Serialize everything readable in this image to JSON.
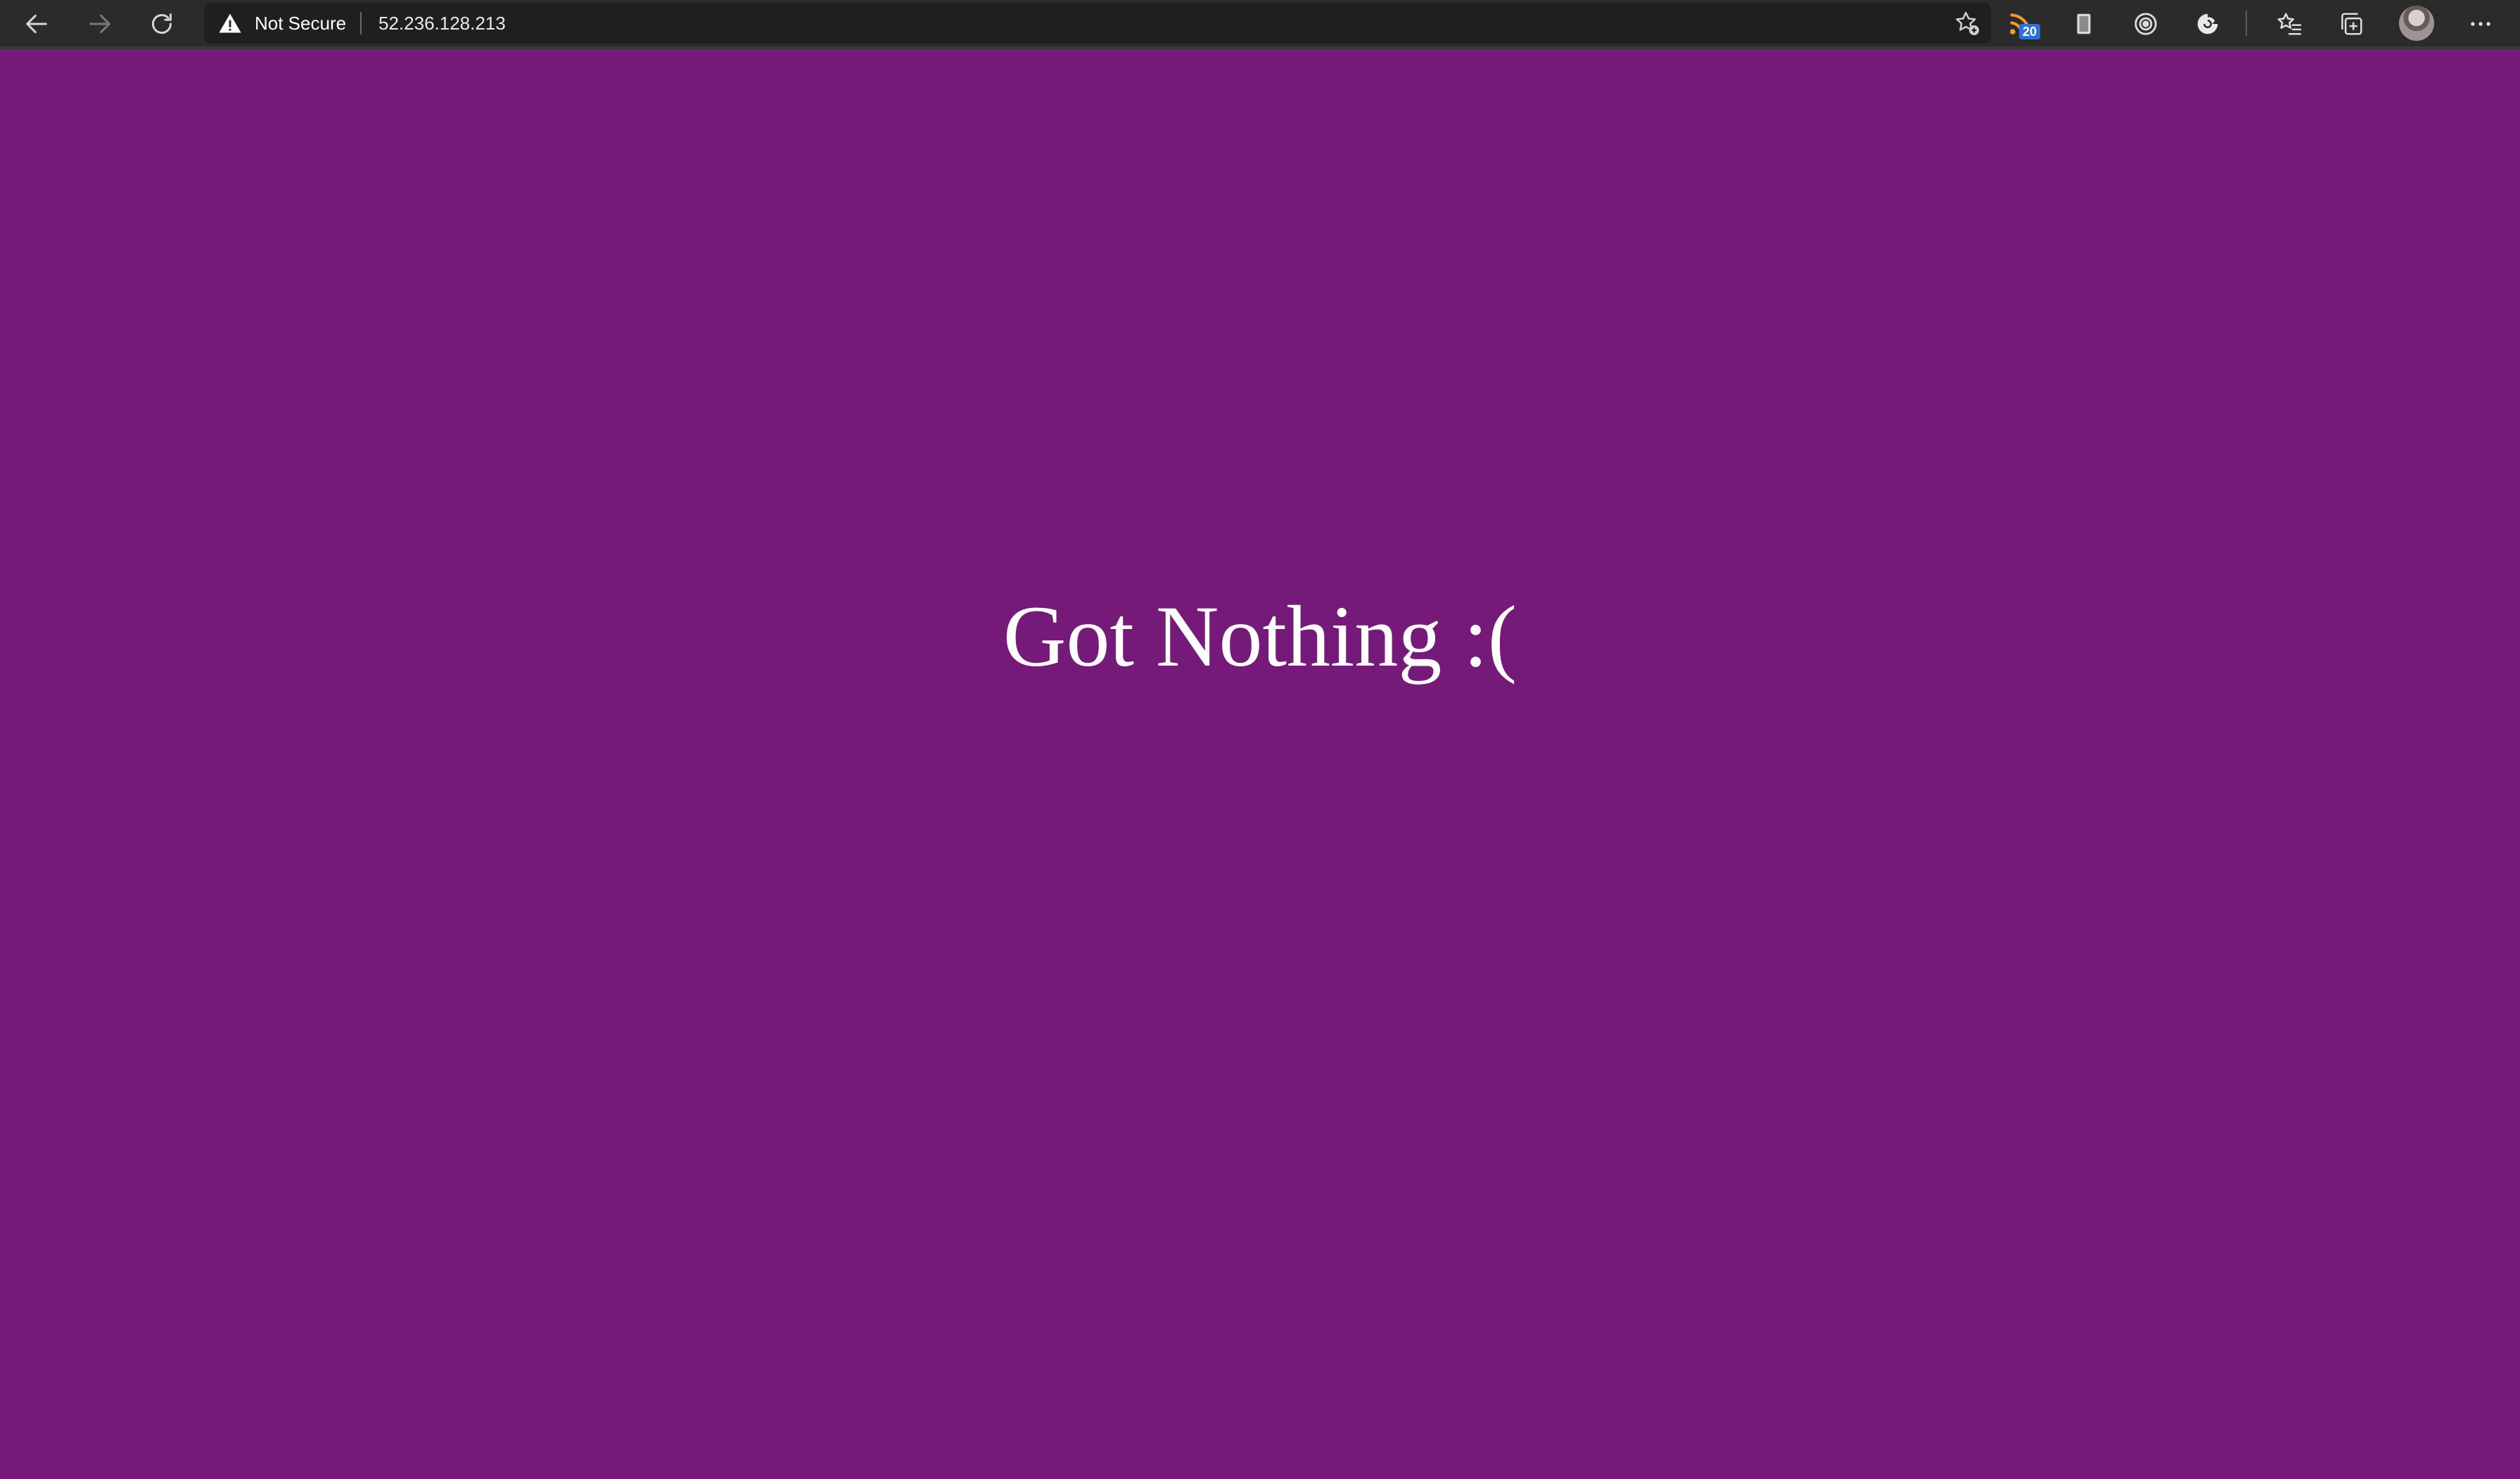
{
  "browser": {
    "address_bar": {
      "security_status": "Not Secure",
      "url": "52.236.128.213"
    },
    "extensions": {
      "rss_badge_count": "20"
    },
    "icons": {
      "back": "back-arrow-icon",
      "forward": "forward-arrow-icon",
      "reload": "reload-icon",
      "warning": "warning-triangle-icon",
      "add_favorite": "star-plus-icon",
      "rss": "rss-feed-icon",
      "extension_2": "bookmark-icon",
      "extension_3": "target-icon",
      "extension_4": "extension-undo-icon",
      "favorites": "favorites-list-icon",
      "collections": "collections-icon",
      "profile": "profile-avatar",
      "menu": "more-options-icon"
    },
    "colors": {
      "toolbar_bg": "#2b2b2b",
      "address_bg": "#1f1f1f",
      "rss_orange": "#f29b28",
      "badge_blue": "#2f6fd6"
    }
  },
  "page": {
    "background_color": "#761a7a",
    "message": "Got Nothing :("
  }
}
